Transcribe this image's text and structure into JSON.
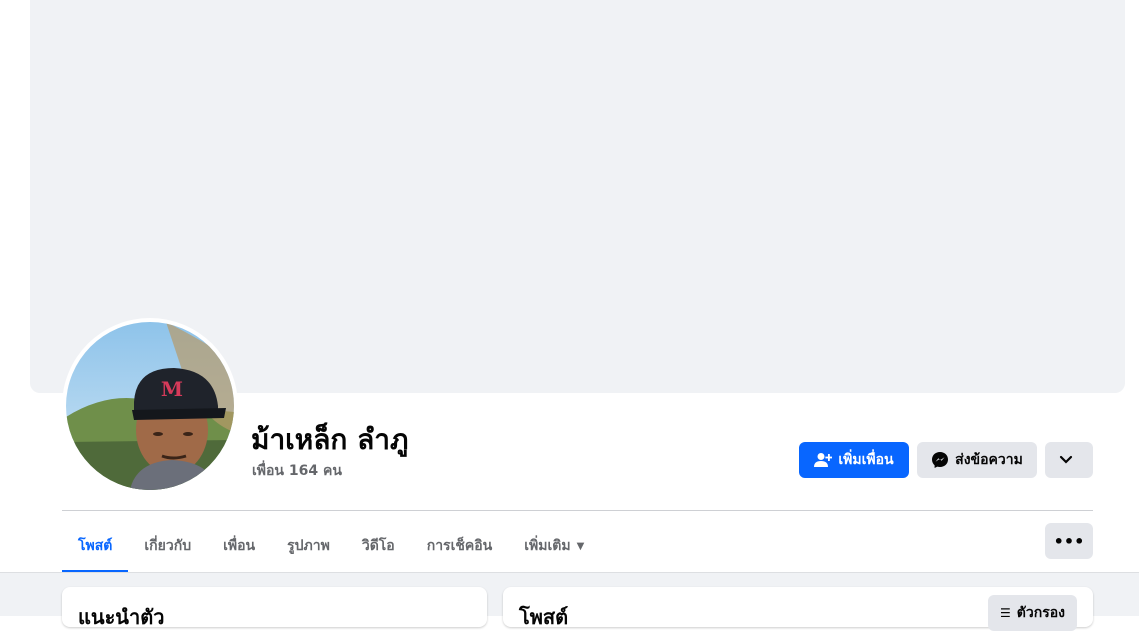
{
  "profile": {
    "name": "ม้าเหล็ก ลำภู",
    "friends_count": "เพื่อน 164 คน"
  },
  "actions": {
    "add_friend": "เพิ่มเพื่อน",
    "message": "ส่งข้อความ"
  },
  "tabs": [
    {
      "label": "โพสต์"
    },
    {
      "label": "เกี่ยวกับ"
    },
    {
      "label": "เพื่อน"
    },
    {
      "label": "รูปภาพ"
    },
    {
      "label": "วิดีโอ"
    },
    {
      "label": "การเช็คอิน"
    },
    {
      "label": "เพิ่มเติม"
    }
  ],
  "cards": {
    "intro_title": "แนะนำตัว",
    "posts_title": "โพสต์",
    "filter_label": "ตัวกรอง"
  },
  "colors": {
    "accent": "#0866ff",
    "cover": "#f0f2f5",
    "button_gray": "#e4e6eb"
  },
  "icons": [
    "add-friend-icon",
    "messenger-icon",
    "chevron-down-icon",
    "more-dots-icon",
    "caret-down-icon",
    "filter-icon"
  ]
}
